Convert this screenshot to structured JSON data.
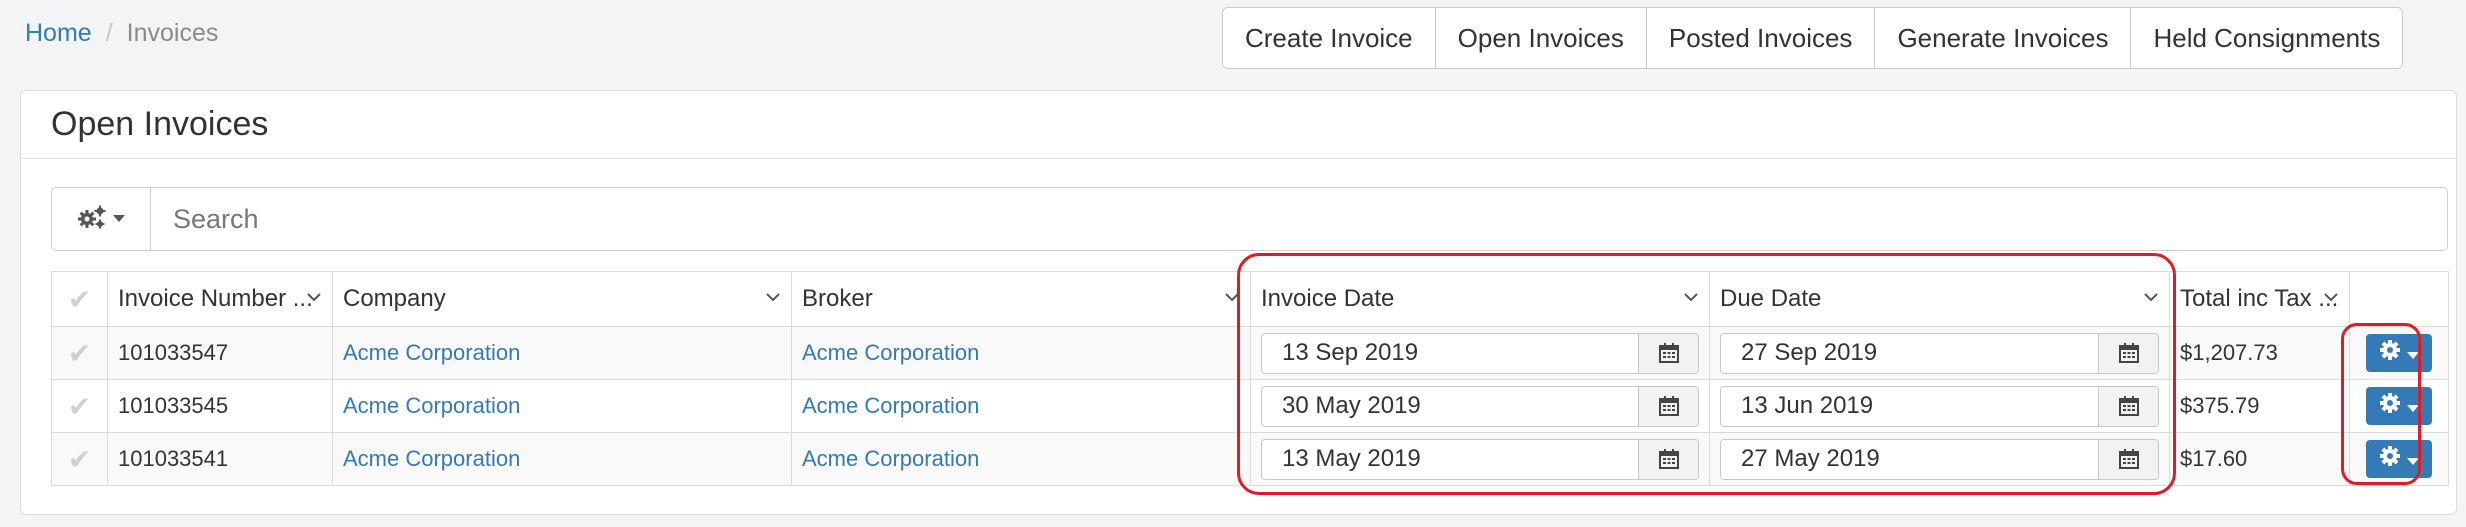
{
  "breadcrumb": {
    "home": "Home",
    "separator": "/",
    "current": "Invoices"
  },
  "toolbar": {
    "buttons": [
      "Create Invoice",
      "Open Invoices",
      "Posted Invoices",
      "Generate Invoices",
      "Held Consignments"
    ]
  },
  "panel": {
    "title": "Open Invoices"
  },
  "search": {
    "placeholder": "Search",
    "value": ""
  },
  "table": {
    "columns": [
      "Invoice Number ...",
      "Company",
      "Broker",
      "Invoice Date",
      "Due Date",
      "Total inc Tax ..."
    ],
    "rows": [
      {
        "invoice_number": "101033547",
        "company": "Acme Corporation",
        "broker": "Acme Corporation",
        "invoice_date": "13 Sep 2019",
        "due_date": "27 Sep 2019",
        "total": "$1,207.73"
      },
      {
        "invoice_number": "101033545",
        "company": "Acme Corporation",
        "broker": "Acme Corporation",
        "invoice_date": "30 May 2019",
        "due_date": "13 Jun 2019",
        "total": "$375.79"
      },
      {
        "invoice_number": "101033541",
        "company": "Acme Corporation",
        "broker": "Acme Corporation",
        "invoice_date": "13 May 2019",
        "due_date": "27 May 2019",
        "total": "$17.60"
      }
    ]
  },
  "colors": {
    "link": "#337ab7",
    "primary_button": "#337ab7",
    "highlight": "#e01b24"
  },
  "icons": {
    "settings": "gears-icon",
    "row_action": "gear-icon",
    "calendar": "calendar-icon",
    "sort": "chevron-down-icon",
    "select": "checkmark-icon"
  }
}
